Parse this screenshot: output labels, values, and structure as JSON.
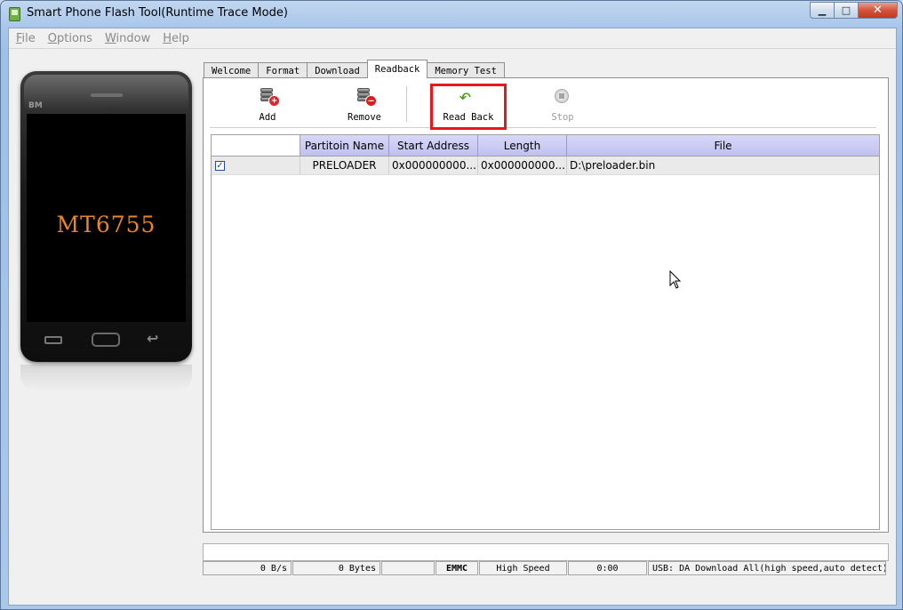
{
  "window": {
    "title": "Smart Phone Flash Tool(Runtime Trace Mode)",
    "minimize": "▁",
    "maximize": "□",
    "close": "✕"
  },
  "menu": [
    {
      "accel": "F",
      "rest": "ile"
    },
    {
      "accel": "O",
      "rest": "ptions"
    },
    {
      "accel": "W",
      "rest": "indow"
    },
    {
      "accel": "H",
      "rest": "elp"
    }
  ],
  "phone": {
    "brand": "BM",
    "chip": "MT6755"
  },
  "tabs": [
    "Welcome",
    "Format",
    "Download",
    "Readback",
    "Memory Test"
  ],
  "active_tab": "Readback",
  "toolbar": {
    "add": "Add",
    "remove": "Remove",
    "read_back": "Read Back",
    "stop": "Stop"
  },
  "icons": {
    "add": "database-add-icon",
    "remove": "database-remove-icon",
    "read_back": "undo-arrow-icon",
    "stop": "stop-icon"
  },
  "colors": {
    "highlight": "#e8171c",
    "chip_text": "#e8861f",
    "header_bg": "#c5c5f2"
  },
  "table": {
    "headers": [
      "",
      "Partitoin Name",
      "Start Address",
      "Length",
      "File"
    ],
    "rows": [
      {
        "checked": true,
        "name": "PRELOADER",
        "start": "0x000000000...",
        "length": "0x000000000...",
        "file": "D:\\preloader.bin"
      }
    ]
  },
  "status": {
    "speed": "0 B/s",
    "bytes": "0 Bytes",
    "blank": "",
    "storage": "EMMC",
    "mode": "High Speed",
    "time": "0:00",
    "connection": "USB: DA Download All(high speed,auto detect)"
  }
}
